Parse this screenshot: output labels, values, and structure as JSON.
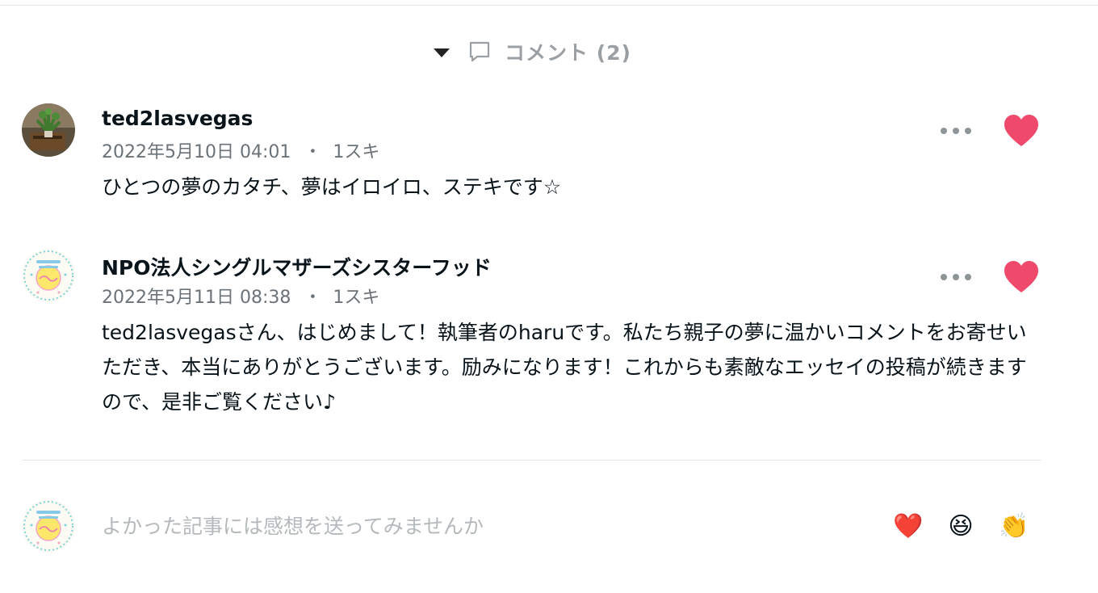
{
  "header": {
    "title": "コメント (2)",
    "caret_icon": "caret-down-icon",
    "bubble_icon": "comment-bubble-icon"
  },
  "comments": [
    {
      "author": "ted2lasvegas",
      "date": "2022年5月10日 04:01",
      "separator": "・",
      "likes": "1スキ",
      "body": "ひとつの夢のカタチ、夢はイロイロ、ステキです☆"
    },
    {
      "author": "NPO法人シングルマザーズシスターフッド",
      "date": "2022年5月11日 08:38",
      "separator": "・",
      "likes": "1スキ",
      "body": "ted2lasvegasさん、はじめまして！執筆者のharuです。私たち親子の夢に温かいコメントをお寄せいただき、本当にありがとうございます。励みになります！これからも素敵なエッセイの投稿が続きますので、是非ご覧ください♪"
    }
  ],
  "composer": {
    "placeholder": "よかった記事には感想を送ってみませんか",
    "emoji_heart": "❤️",
    "emoji_laugh": "😆",
    "emoji_clap": "👏"
  },
  "colors": {
    "like_heart": "#ef4a6b",
    "header_text": "#9a9fa3",
    "meta_text": "#6b7378",
    "placeholder": "#b4b9bc"
  }
}
